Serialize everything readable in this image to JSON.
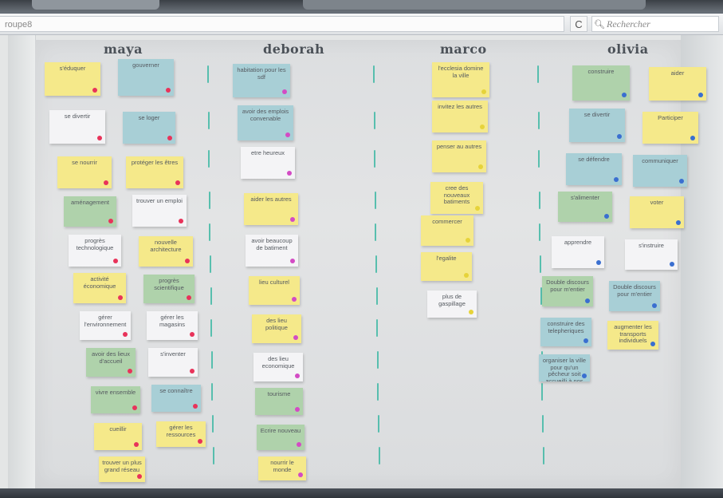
{
  "browser": {
    "url_text": "roupe8",
    "reload_glyph": "C",
    "search_placeholder": "Rechercher"
  },
  "columns": [
    {
      "name": "maya",
      "dot_color": "#e8335a"
    },
    {
      "name": "deborah",
      "dot_color": "#d34bc4"
    },
    {
      "name": "marco",
      "dot_color": "#e6d33a"
    },
    {
      "name": "olivia",
      "dot_color": "#3a6fd0"
    }
  ],
  "notes": {
    "maya": [
      "s'éduquer",
      "gouverner",
      "se divertir",
      "se loger",
      "se nourrir",
      "protéger les êtres",
      "aménagement",
      "trouver un emploi",
      "progrès technologique",
      "nouvelle architecture",
      "activité économique",
      "progrès scientifique",
      "gérer l'environnement",
      "gérer les magasins",
      "avoir des lieux d'accueil",
      "s'inventer",
      "vivre ensemble",
      "se connaître",
      "cueillir",
      "gérer les ressources",
      "trouver un plus grand réseau"
    ],
    "deborah": [
      "habitation pour les sdf",
      "avoir des emplois convenable",
      "etre heureux",
      "aider les autres",
      "avoir beaucoup de batiment",
      "lieu culturel",
      "des lieu politique",
      "des lieu economique",
      "tourisme",
      "Ecrire nouveau",
      "nourrir le monde"
    ],
    "marco": [
      "l'ecclesia domine la ville",
      "invitez les autres",
      "penser au autres",
      "cree des nouveaux batiments",
      "commercer",
      "l'egalite",
      "plus de gaspillage"
    ],
    "olivia": [
      "construire",
      "aider",
      "se divertir",
      "Participer",
      "se défendre",
      "communiquer",
      "s'alimenter",
      "voter",
      "apprendre",
      "s'instruire",
      "Double discours pour m'entier",
      "Double discours pour m'entier",
      "construire des telepheriques",
      "augmenter les transports individuels",
      "organiser la ville pour qu'un pêcheur soit accueilli à nos bateaux"
    ]
  }
}
